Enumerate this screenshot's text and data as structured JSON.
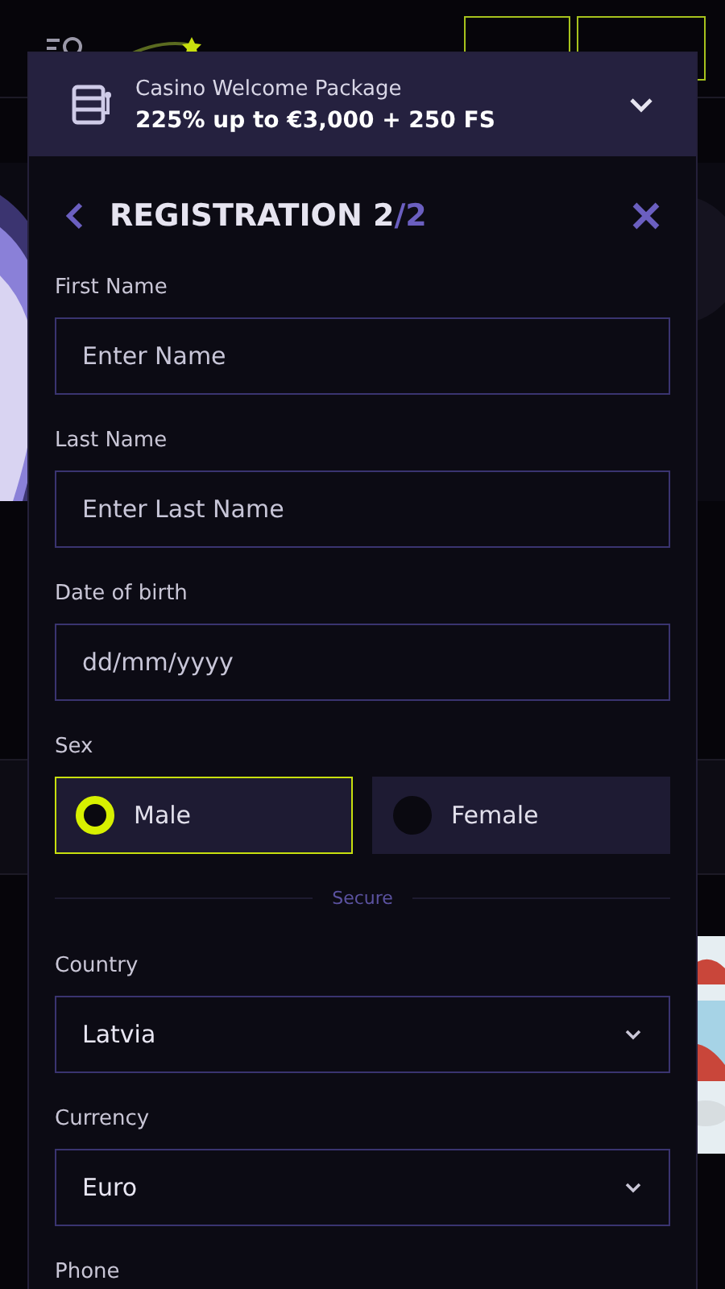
{
  "promo": {
    "title": "Casino Welcome Package",
    "offer": "225% up to €3,000 + 250 FS",
    "expanded": false
  },
  "dialog": {
    "title": "REGISTRATION 2",
    "step": "/2",
    "fields": [
      {
        "kind": "text",
        "label": "First Name",
        "placeholder": "Enter Name"
      },
      {
        "kind": "text",
        "label": "Last Name",
        "placeholder": "Enter Last Name"
      },
      {
        "kind": "text",
        "label": "Date of birth",
        "placeholder": "dd/mm/yyyy"
      },
      {
        "kind": "radio",
        "label": "Sex",
        "options": [
          {
            "label": "Male",
            "selected": true
          },
          {
            "label": "Female",
            "selected": false
          }
        ]
      },
      {
        "kind": "divider",
        "label": "Secure"
      },
      {
        "kind": "select",
        "label": "Country",
        "value": "Latvia"
      },
      {
        "kind": "select",
        "label": "Currency",
        "value": "Euro"
      },
      {
        "kind": "text",
        "label": "Phone"
      }
    ]
  }
}
